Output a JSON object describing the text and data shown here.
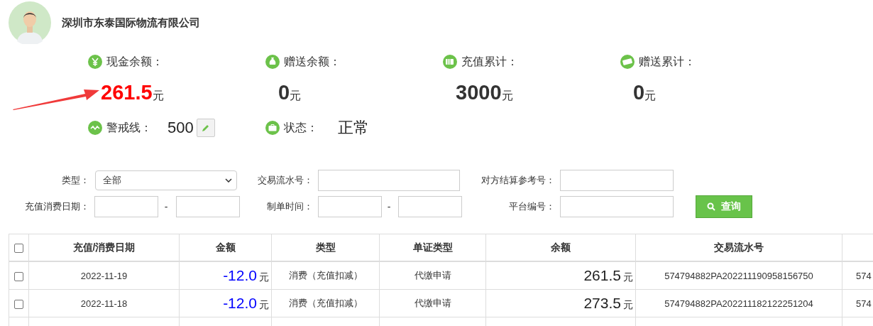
{
  "company": {
    "name": "深圳市东泰国际物流有限公司"
  },
  "stats": [
    {
      "kind": "cash",
      "label": "现金余额：",
      "value": "261.5",
      "unit": "元",
      "emphasis": true
    },
    {
      "kind": "gift",
      "label": "赠送余额：",
      "value": "0",
      "unit": "元",
      "emphasis": false
    },
    {
      "kind": "recharge",
      "label": "充值累计：",
      "value": "3000",
      "unit": "元",
      "emphasis": false
    },
    {
      "kind": "giftsum",
      "label": "赠送累计：",
      "value": "0",
      "unit": "元",
      "emphasis": false
    }
  ],
  "status_items": [
    {
      "kind": "alert",
      "label": "警戒线：",
      "value": "500"
    },
    {
      "kind": "status",
      "label": "状态：",
      "value": "正常"
    }
  ],
  "filters": {
    "type_label": "类型：",
    "type_value": "全部",
    "serial_label": "交易流水号：",
    "ref_label": "对方结算参考号：",
    "date_label": "充值消费日期：",
    "date_sep": "-",
    "made_label": "制单时间：",
    "made_sep": "-",
    "platform_label": "平台编号：",
    "search_button": "查询"
  },
  "table": {
    "all_checked": false,
    "columns": [
      "充值/消费日期",
      "金额",
      "类型",
      "单证类型",
      "余额",
      "交易流水号"
    ],
    "rows": [
      {
        "checked": false,
        "date": "2022-11-19",
        "amount": "-12.0",
        "amount_unit": "元",
        "type": "消费（充值扣减）",
        "voucher_type": "代缴申请",
        "balance": "261.5",
        "balance_unit": "元",
        "serial": "574794882PA202211190958156750",
        "column_7": "574"
      },
      {
        "checked": false,
        "date": "2022-11-18",
        "amount": "-12.0",
        "amount_unit": "元",
        "type": "消费（充值扣减）",
        "voucher_type": "代缴申请",
        "balance": "273.5",
        "balance_unit": "元",
        "serial": "574794882PA202211182122251204",
        "column_7": "574"
      }
    ]
  }
}
